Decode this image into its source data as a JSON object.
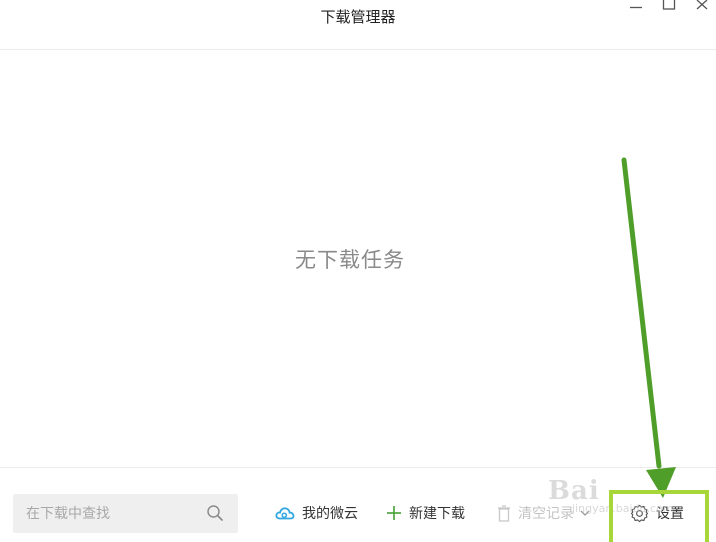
{
  "window": {
    "title": "下载管理器"
  },
  "main": {
    "empty_message": "无下载任务"
  },
  "bottom_bar": {
    "search": {
      "placeholder": "在下载中查找",
      "value": ""
    },
    "actions": {
      "my_cloud_label": "我的微云",
      "new_download_label": "新建下载",
      "clear_records_label": "清空记录",
      "settings_label": "设置"
    }
  },
  "watermark": {
    "text": "Bai",
    "sub": "jingyan.baidu.com"
  },
  "colors": {
    "accent_green": "#45a035",
    "annotation_green": "#4f9e2a",
    "annotation_box": "#a6d63a",
    "cloud_blue": "#33a7e0",
    "empty_text": "#8a8a8a"
  },
  "icons": {
    "minimize": "minimize-icon",
    "maximize": "maximize-icon",
    "close": "close-icon",
    "search": "search-icon",
    "cloud": "cloud-icon",
    "plus": "plus-icon",
    "trash": "trash-icon",
    "chevron": "chevron-down-icon",
    "gear": "gear-icon"
  }
}
